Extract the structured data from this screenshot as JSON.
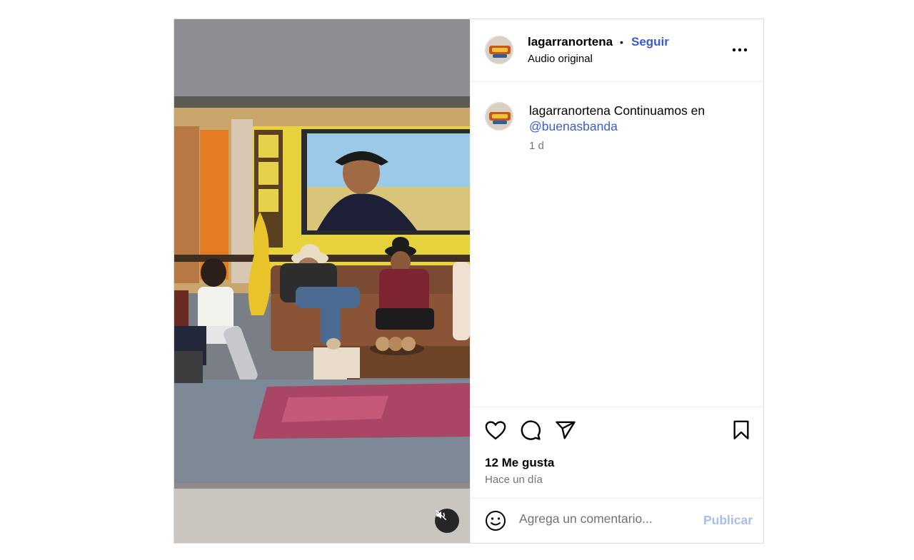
{
  "post": {
    "username": "lagarranortena",
    "separator": "•",
    "follow_label": "Seguir",
    "audio_label": "Audio original",
    "caption": {
      "username": "lagarranortena",
      "text": "Continuamos en",
      "mention": "@buenasbanda",
      "time": "1 d"
    },
    "likes": "12 Me gusta",
    "posted_ago": "Hace un día",
    "comment": {
      "placeholder": "Agrega un comentario...",
      "publish_label": "Publicar"
    }
  },
  "icons": {
    "more": "more-horizontal-icon",
    "like": "heart-icon",
    "comment": "comment-bubble-icon",
    "share": "paper-plane-icon",
    "save": "bookmark-icon",
    "emoji": "smiley-icon",
    "mute": "speaker-muted-icon"
  },
  "colors": {
    "link": "#3a5bd9",
    "publish_disabled": "#a9bde9",
    "secondary_text": "#737373",
    "border": "#dbdbdb"
  }
}
